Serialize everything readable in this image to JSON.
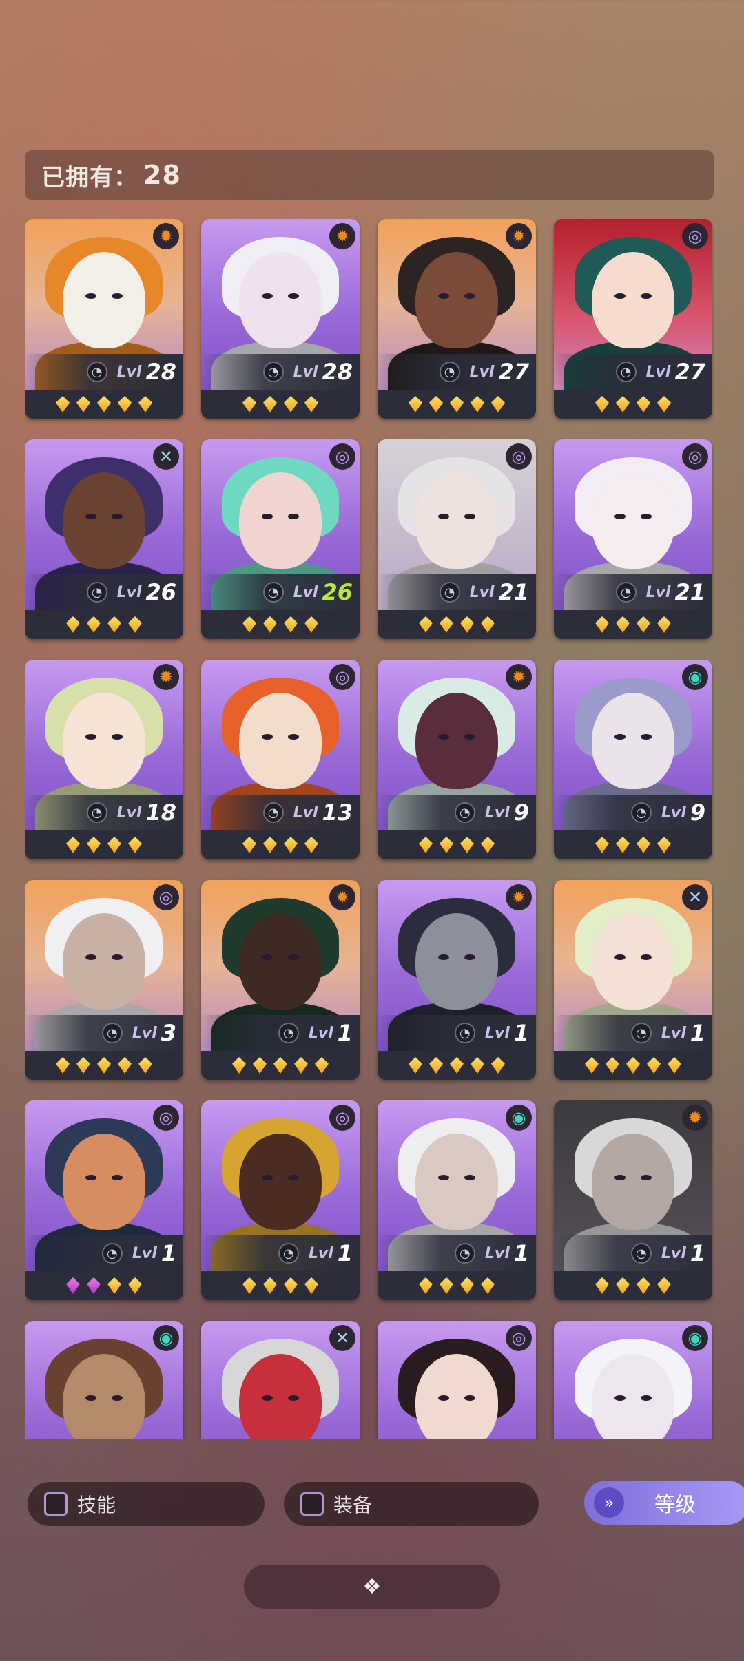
{
  "owned": {
    "label": "已拥有：",
    "count": "28"
  },
  "heroes": [
    {
      "level": "28",
      "badge": "sun",
      "stars": 5,
      "bg": "orange",
      "skin": "#f2efe9",
      "hair": "#e8862a",
      "green": false
    },
    {
      "level": "28",
      "badge": "sun",
      "stars": 4,
      "bg": "purple",
      "skin": "#efe2ee",
      "hair": "#f0eef5",
      "green": false
    },
    {
      "level": "27",
      "badge": "sun",
      "stars": 5,
      "bg": "orange",
      "skin": "#7a4b39",
      "hair": "#2b2422",
      "green": false
    },
    {
      "level": "27",
      "badge": "moon",
      "stars": 4,
      "bg": "red",
      "skin": "#f5dccf",
      "hair": "#1f5a57",
      "green": false
    },
    {
      "level": "26",
      "badge": "cross",
      "stars": 4,
      "bg": "purple",
      "skin": "#6b4232",
      "hair": "#3c2f6a",
      "green": false
    },
    {
      "level": "26",
      "badge": "moon",
      "stars": 4,
      "bg": "purple",
      "skin": "#f0d4cf",
      "hair": "#6fd8c1",
      "green": true
    },
    {
      "level": "21",
      "badge": "moon",
      "stars": 4,
      "bg": "grey",
      "skin": "#efe3df",
      "hair": "#e6e3e6",
      "green": false
    },
    {
      "level": "21",
      "badge": "moon",
      "stars": 4,
      "bg": "purple",
      "skin": "#f4ecef",
      "hair": "#f1edf2",
      "green": false
    },
    {
      "level": "18",
      "badge": "sun",
      "stars": 4,
      "bg": "purple",
      "skin": "#f6e4d6",
      "hair": "#d6e0a8",
      "green": false
    },
    {
      "level": "13",
      "badge": "moon",
      "stars": 4,
      "bg": "purple",
      "skin": "#f2dccb",
      "hair": "#e9612a",
      "green": false
    },
    {
      "level": "9",
      "badge": "sun",
      "stars": 4,
      "bg": "purple",
      "skin": "#5a2c3e",
      "hair": "#d9ece4",
      "green": false
    },
    {
      "level": "9",
      "badge": "swirl",
      "stars": 4,
      "bg": "purple",
      "skin": "#ebe3ea",
      "hair": "#9a9acb",
      "green": false
    },
    {
      "level": "3",
      "badge": "moon",
      "stars": 5,
      "bg": "orange",
      "skin": "#c8b0a4",
      "hair": "#f0eff2",
      "green": false
    },
    {
      "level": "1",
      "badge": "sun",
      "stars": 5,
      "bg": "orange",
      "skin": "#3d2a24",
      "hair": "#1e3b2e",
      "green": false
    },
    {
      "level": "1",
      "badge": "sun",
      "stars": 5,
      "bg": "purple",
      "skin": "#8c8f9c",
      "hair": "#2a2e3c",
      "green": false
    },
    {
      "level": "1",
      "badge": "cross",
      "stars": 5,
      "bg": "orange",
      "skin": "#f4e2d6",
      "hair": "#e3efc9",
      "green": false
    },
    {
      "level": "1",
      "badge": "moon",
      "stars": 4,
      "bg": "purple",
      "skin": "#d68d60",
      "hair": "#2c3a57",
      "green": false,
      "pinkStars": 2
    },
    {
      "level": "1",
      "badge": "moon",
      "stars": 4,
      "bg": "purple",
      "skin": "#4a2c22",
      "hair": "#d8a431",
      "green": false
    },
    {
      "level": "1",
      "badge": "swirl",
      "stars": 4,
      "bg": "purple",
      "skin": "#d9c9c2",
      "hair": "#eeeef0",
      "green": false
    },
    {
      "level": "1",
      "badge": "sun",
      "stars": 4,
      "bg": "dark",
      "skin": "#b4a8a2",
      "hair": "#d8d8d8",
      "green": false
    },
    {
      "level": "",
      "badge": "swirl",
      "stars": 0,
      "bg": "purple",
      "skin": "#b58a6a",
      "hair": "#6a4030",
      "green": false
    },
    {
      "level": "",
      "badge": "cross",
      "stars": 0,
      "bg": "purple",
      "skin": "#c7303b",
      "hair": "#d7d7d7",
      "green": false
    },
    {
      "level": "",
      "badge": "moon",
      "stars": 0,
      "bg": "purple",
      "skin": "#f0d9cf",
      "hair": "#2a1b1e",
      "green": false
    },
    {
      "level": "",
      "badge": "swirl",
      "stars": 0,
      "bg": "purple",
      "skin": "#ede6ec",
      "hair": "#f4f4f8",
      "green": false
    }
  ],
  "lvl_label": "Lvl",
  "badge_icons": {
    "sun": "✹",
    "moon": "◎",
    "swirl": "◉",
    "cross": "✕"
  },
  "filters": {
    "skill": "技能",
    "equip": "装备"
  },
  "sort": {
    "label": "等级",
    "icon": "»"
  },
  "bottom_icon": "❖"
}
